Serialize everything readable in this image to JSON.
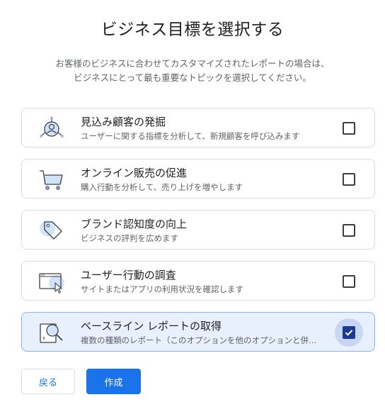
{
  "title": "ビジネス目標を選択する",
  "subtitle": {
    "line1": "お客様のビジネスに合わせてカスタマイズされたレポートの場合は、",
    "line2": "ビジネスにとって最も重要なトピックを選択してください。"
  },
  "options": [
    {
      "title": "見込み顧客の発掘",
      "description": "ユーザーに関する指標を分析して、新規顧客を呼び込みます",
      "icon": "lead-generation-icon",
      "checked": false
    },
    {
      "title": "オンライン販売の促進",
      "description": "購入行動を分析して、売り上げを増やします",
      "icon": "shopping-cart-icon",
      "checked": false
    },
    {
      "title": "ブランド認知度の向上",
      "description": "ビジネスの評判を広めます",
      "icon": "tag-icon",
      "checked": false
    },
    {
      "title": "ユーザー行動の調査",
      "description": "サイトまたはアプリの利用状況を確認します",
      "icon": "browser-cursor-icon",
      "checked": false
    },
    {
      "title": "ベースライン レポートの取得",
      "description": "複数の種類のレポート（このオプションを他のオプションと併…",
      "icon": "magnifier-report-icon",
      "checked": true
    }
  ],
  "buttons": {
    "back": "戻る",
    "create": "作成"
  },
  "colors": {
    "accent": "#1a73e8",
    "selected_bg": "#e8f0fe",
    "checkbox_checked": "#1a3a8f"
  }
}
